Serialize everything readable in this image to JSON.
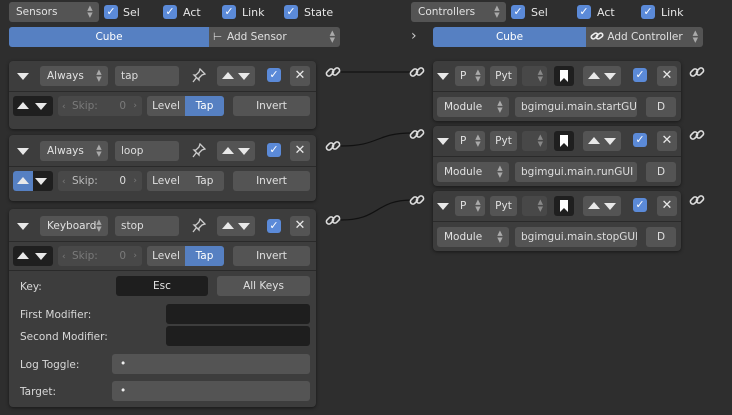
{
  "sensors_header": {
    "dropdown": "Sensors",
    "sel": "Sel",
    "act": "Act",
    "link": "Link",
    "state": "State",
    "object_tab": "Cube",
    "add_button": "Add Sensor"
  },
  "controllers_header": {
    "dropdown": "Controllers",
    "sel": "Sel",
    "act": "Act",
    "link": "Link",
    "object_tab": "Cube",
    "add_button": "Add Controller",
    "expand_arrow": "›"
  },
  "sensors": [
    {
      "type": "Always",
      "name": "tap",
      "skip_label": "Skip:",
      "skip_value": "0",
      "level": "Level",
      "tap": "Tap",
      "invert": "Invert"
    },
    {
      "type": "Always",
      "name": "loop",
      "skip_label": "Skip:",
      "skip_value": "0",
      "level": "Level",
      "tap": "Tap",
      "invert": "Invert"
    },
    {
      "type": "Keyboard",
      "name": "stop",
      "skip_label": "Skip:",
      "skip_value": "0",
      "level": "Level",
      "tap": "Tap",
      "invert": "Invert",
      "key_label": "Key:",
      "key_value": "Esc",
      "all_keys": "All Keys",
      "first_modifier": "First Modifier:",
      "second_modifier": "Second Modifier:",
      "log_toggle": "Log Toggle:",
      "target": "Target:",
      "log_toggle_value": "•",
      "target_value": "•"
    }
  ],
  "controllers": [
    {
      "type": "P",
      "lang": "Pyt",
      "mode": "Module",
      "module": "bgimgui.main.startGUI",
      "debug": "D"
    },
    {
      "type": "P",
      "lang": "Pyt",
      "mode": "Module",
      "module": "bgimgui.main.runGUI",
      "debug": "D"
    },
    {
      "type": "P",
      "lang": "Pyt",
      "mode": "Module",
      "module": "bgimgui.main.stopGUI",
      "debug": "D"
    }
  ],
  "colors": {
    "background": "#2e2e2e",
    "panel": "#3d3d3d",
    "accent": "#5680c2",
    "field": "#545454"
  }
}
